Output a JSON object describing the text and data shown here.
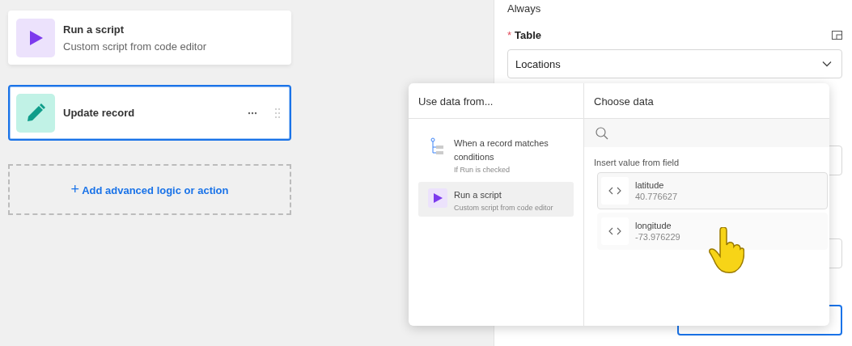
{
  "steps": [
    {
      "kind": "script",
      "title": "Run a script",
      "subtitle": "Custom script from code editor",
      "selected": false
    },
    {
      "kind": "update",
      "title": "Update record",
      "selected": true
    }
  ],
  "add_action": {
    "icon": "+",
    "label": "Add advanced logic or action"
  },
  "config": {
    "condition": "Always",
    "table_label": "Table",
    "required_mark": "*",
    "table_value": "Locations"
  },
  "popup": {
    "left_title": "Use data from...",
    "sources": [
      {
        "kind": "trigger",
        "title": "When a record matches conditions",
        "subtitle": "If Run is checked",
        "selected": false
      },
      {
        "kind": "script",
        "title": "Run a script",
        "subtitle": "Custom script from code editor",
        "selected": true
      }
    ],
    "right_title": "Choose data",
    "section_label": "Insert value from field",
    "fields": [
      {
        "name": "latitude",
        "value": "40.776627",
        "selected": true
      },
      {
        "name": "longitude",
        "value": "-73.976229",
        "selected": false
      }
    ]
  }
}
